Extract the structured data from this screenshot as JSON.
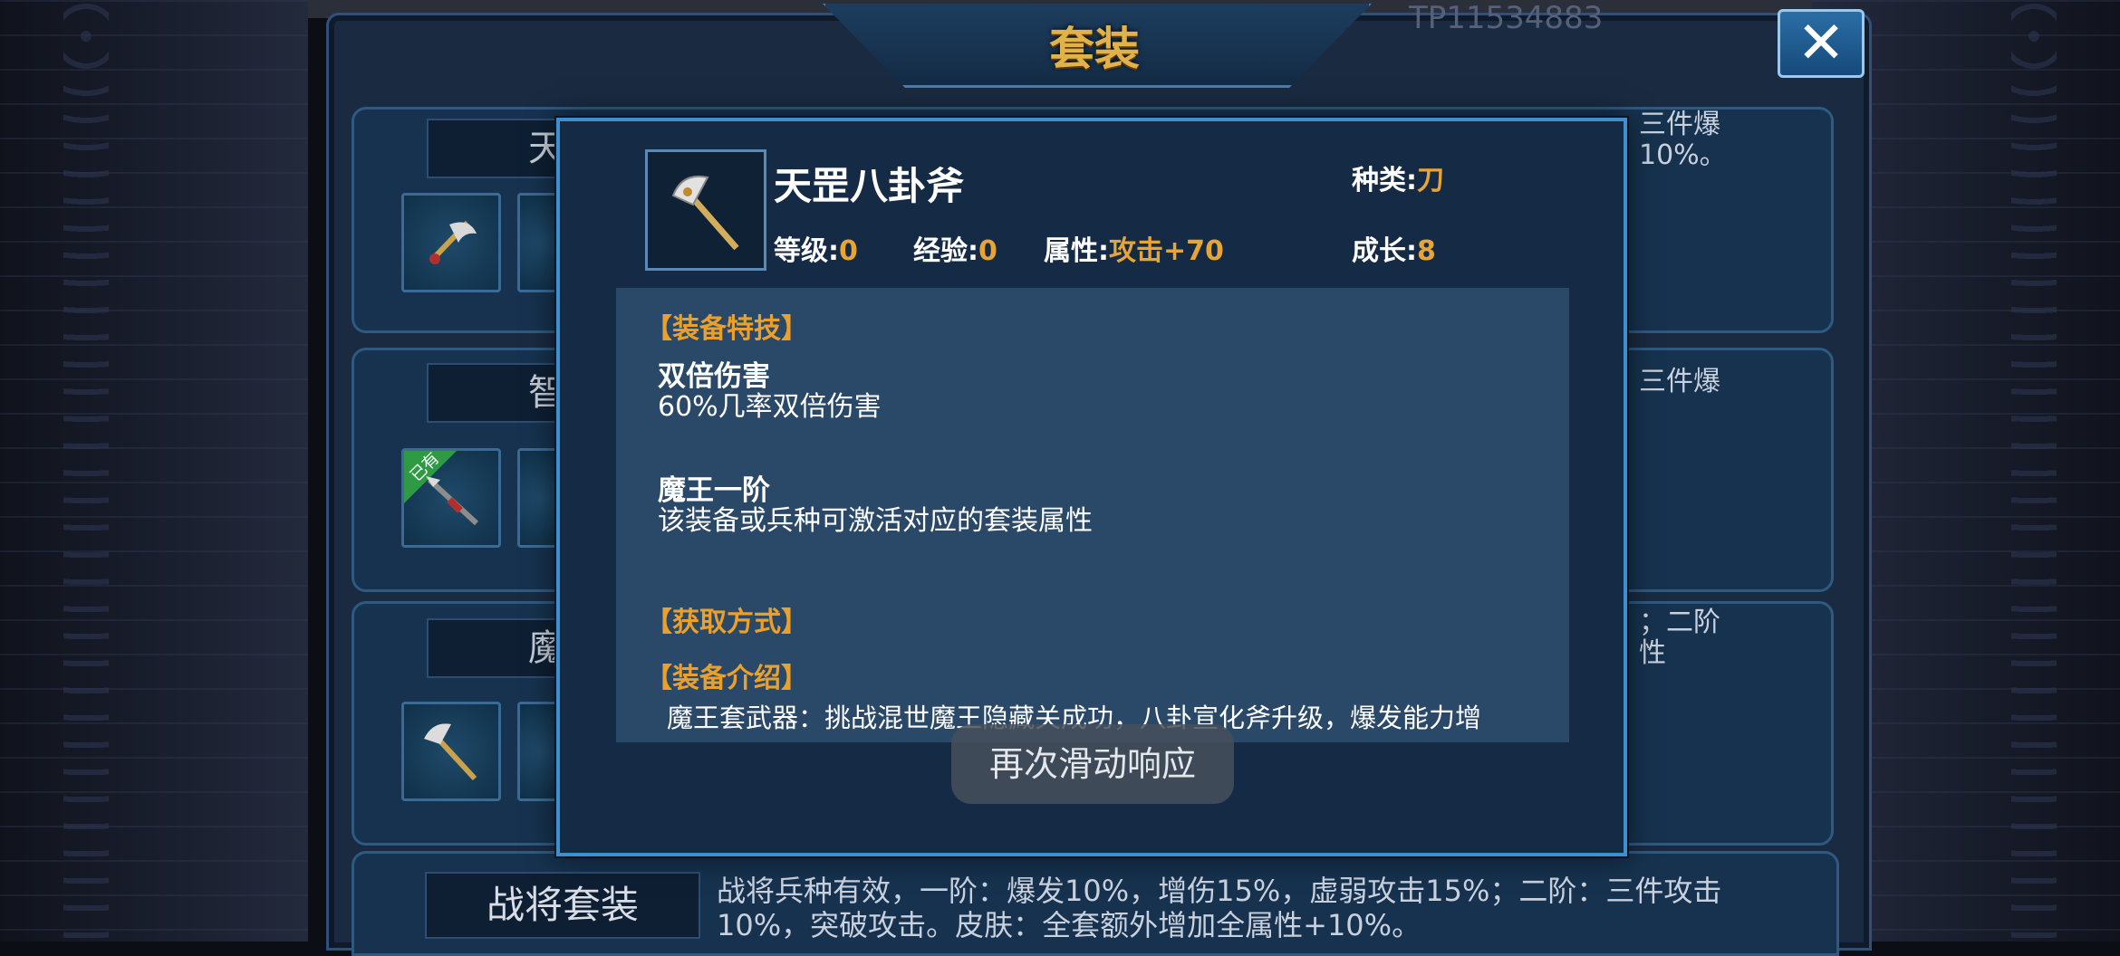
{
  "window": {
    "title": "套装",
    "close_symbol": "✕",
    "ghost_id": "TP11534883"
  },
  "sets": [
    {
      "name": "天师",
      "desc_lines": [
        "三件爆",
        "10%。"
      ]
    },
    {
      "name": "智将",
      "desc_lines": [
        "三件爆"
      ],
      "owned_badge": "已有"
    },
    {
      "name": "魔王",
      "desc_lines": [
        "；二阶",
        "性"
      ]
    }
  ],
  "bottom_set": {
    "name": "战将套装",
    "desc": "战将兵种有效，一阶：爆发10%，增伤15%，虚弱攻击15%；二阶：三件攻击10%，突破攻击。皮肤：全套额外增加全属性+10%。"
  },
  "item": {
    "name": "天罡八卦斧",
    "icon": "golden-axe-icon",
    "type_label": "种类:",
    "type_value": "刀",
    "level_label": "等级:",
    "level_value": "0",
    "exp_label": "经验:",
    "exp_value": "0",
    "attr_label": "属性:",
    "attr_value": "攻击+70",
    "growth_label": "成长:",
    "growth_value": "8"
  },
  "details": {
    "skills_header": "【装备特技】",
    "skills": [
      {
        "name": "双倍伤害",
        "desc": "60%几率双倍伤害"
      },
      {
        "name": "魔王一阶",
        "desc": "该装备或兵种可激活对应的套装属性"
      }
    ],
    "obtain_header": "【获取方式】",
    "intro_header": "【装备介绍】",
    "intro_text": "魔王套武器：挑战混世魔王隐藏关成功，八卦宣化斧升级，爆发能力增"
  },
  "toast": "再次滑动响应",
  "colors": {
    "accent_gold": "#e6a534",
    "header_orange": "#eaa02a",
    "popup_border": "#3e8fd0"
  }
}
